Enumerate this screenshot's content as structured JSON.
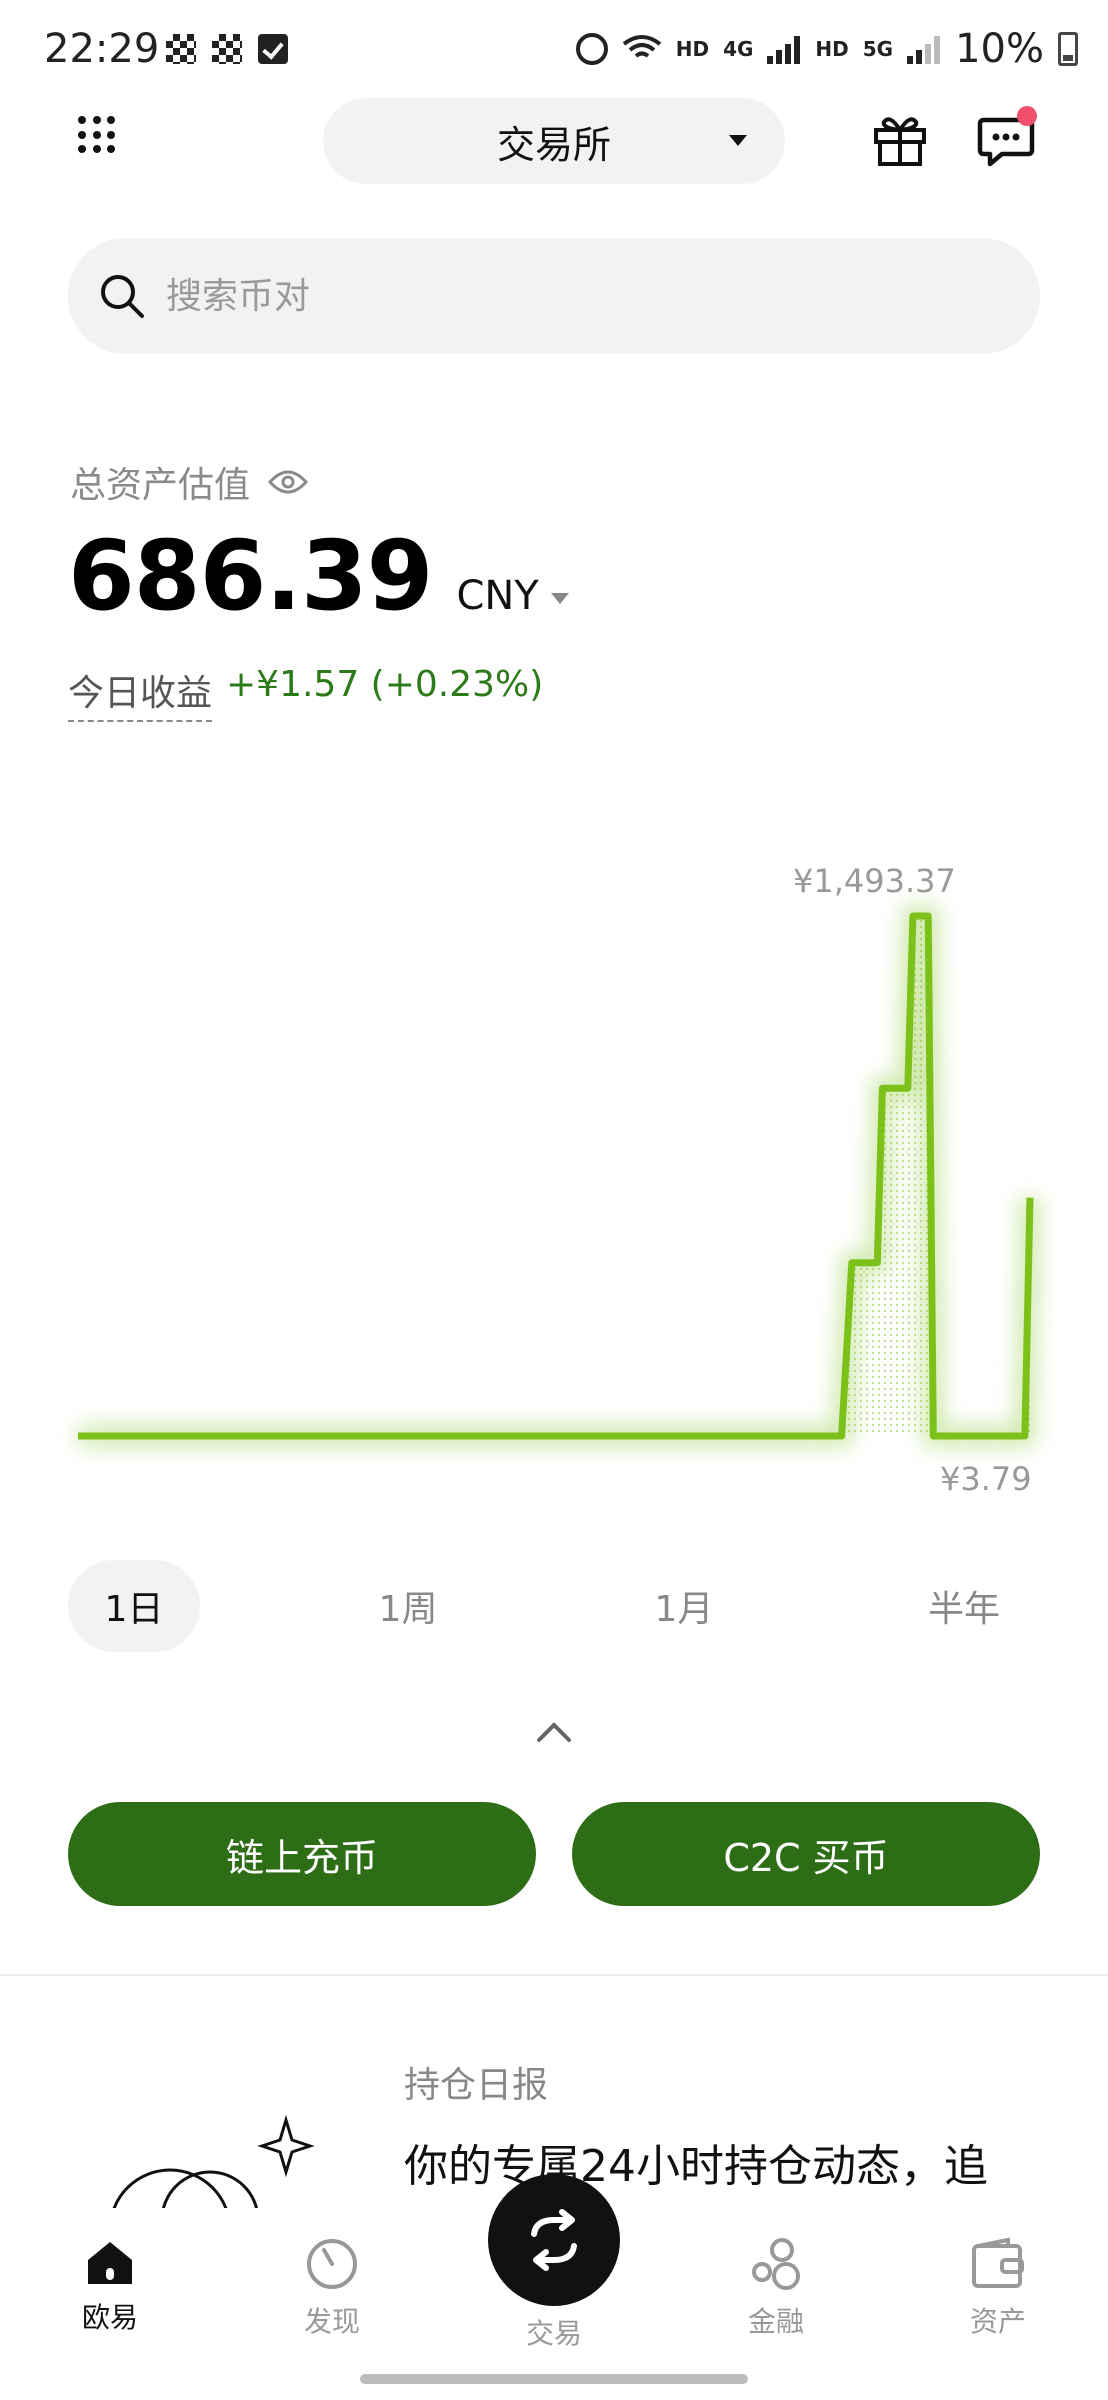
{
  "status_bar": {
    "time": "22:29",
    "network_labels": [
      "HD",
      "4G",
      "HD",
      "5G"
    ],
    "battery": "10%"
  },
  "header": {
    "exchange_label": "交易所"
  },
  "search": {
    "placeholder": "搜索币对"
  },
  "assets": {
    "label": "总资产估值",
    "value": "686.39",
    "currency": "CNY",
    "pnl_label": "今日收益",
    "pnl_value": "+¥1.57 (+0.23%)"
  },
  "chart": {
    "max_label": "¥1,493.37",
    "min_label": "¥3.79",
    "line_color": "#7cc11a"
  },
  "chart_data": {
    "type": "line",
    "x": [
      0,
      0.75,
      0.76,
      0.785,
      0.79,
      0.815,
      0.82,
      0.835,
      0.84,
      0.86,
      0.87,
      0.93,
      0.935
    ],
    "y": [
      3.79,
      3.79,
      500,
      500,
      1000,
      1000,
      1493.37,
      1493.37,
      3.79,
      3.79,
      3.79,
      3.79,
      686.39
    ],
    "ylim": [
      3.79,
      1493.37
    ],
    "annotations": [
      "¥1,493.37",
      "¥3.79"
    ]
  },
  "range_tabs": [
    "1日",
    "1周",
    "1月",
    "半年"
  ],
  "actions": {
    "deposit": "链上充币",
    "c2c_buy": "C2C 买币"
  },
  "report": {
    "title": "持仓日报",
    "text": "你的专属24小时持仓动态，追"
  },
  "bottom_nav": {
    "items": [
      "欧易",
      "发现",
      "交易",
      "金融",
      "资产"
    ]
  },
  "colors": {
    "brand_green": "#2d6d16",
    "positive": "#2c7a1a",
    "notification": "#f0506e"
  }
}
